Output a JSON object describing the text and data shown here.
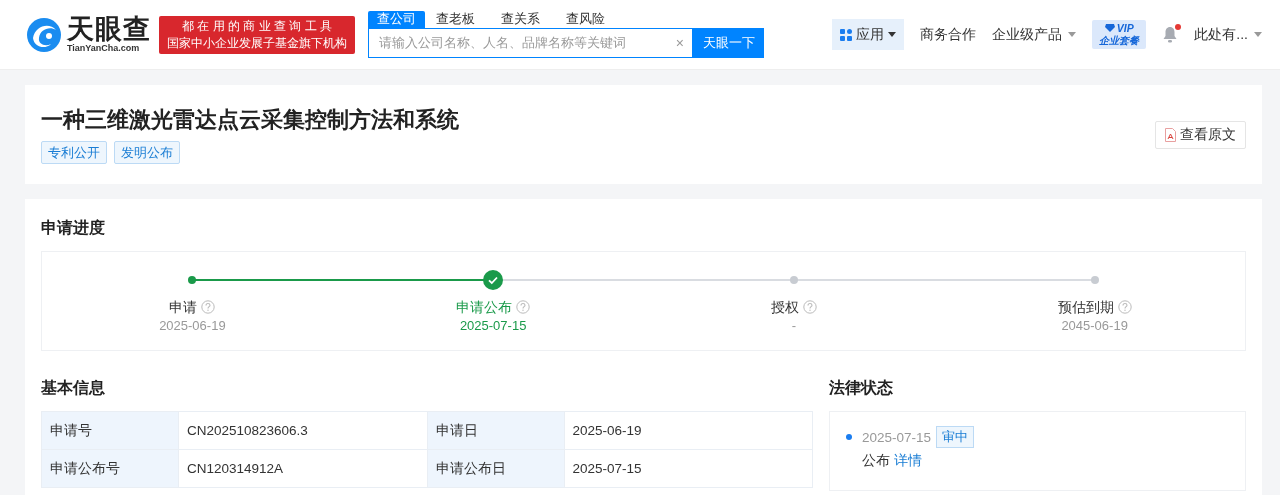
{
  "header": {
    "logo": {
      "name": "天眼查",
      "domain": "TianYanCha.com"
    },
    "slogan": [
      "都 在 用 的 商 业 查 询 工 具",
      "国家中小企业发展子基金旗下机构"
    ],
    "search_tabs": [
      {
        "label": "查公司",
        "selected": true
      },
      {
        "label": "查老板",
        "selected": false
      },
      {
        "label": "查关系",
        "selected": false
      },
      {
        "label": "查风险",
        "selected": false
      }
    ],
    "search": {
      "placeholder": "请输入公司名称、人名、品牌名称等关键词",
      "clear": "×",
      "button": "天眼一下"
    },
    "nav": [
      {
        "kind": "apps",
        "label": "应用"
      },
      {
        "kind": "link",
        "label": "商务合作"
      },
      {
        "kind": "dropdown",
        "label": "企业级产品"
      },
      {
        "kind": "vip",
        "label": "VIP",
        "sublabel": "企业套餐"
      },
      {
        "kind": "bell",
        "unread": true
      },
      {
        "kind": "dropdown",
        "label": "此处有..."
      }
    ]
  },
  "patent": {
    "title": "一种三维激光雷达点云采集控制方法和系统",
    "tags": [
      "专利公开",
      "发明公布"
    ],
    "view_button": "查看原文"
  },
  "progress": {
    "heading": "申请进度",
    "steps": [
      {
        "label": "申请",
        "date": "2025-06-19",
        "kind": "done"
      },
      {
        "label": "申请公布",
        "date": "2025-07-15",
        "kind": "current"
      },
      {
        "label": "授权",
        "date": "-",
        "kind": "pending"
      },
      {
        "label": "预估到期",
        "date": "2045-06-19",
        "kind": "pending"
      }
    ]
  },
  "basic_info": {
    "heading": "基本信息",
    "rows": [
      {
        "fields": [
          {
            "label": "申请号",
            "value": "CN202510823606.3"
          },
          {
            "label": "申请日",
            "value": "2025-06-19"
          }
        ]
      },
      {
        "fields": [
          {
            "label": "申请公布号",
            "value": "CN120314912A"
          },
          {
            "label": "申请公布日",
            "value": "2025-07-15"
          }
        ]
      }
    ]
  },
  "legal_status": {
    "heading": "法律状态",
    "events": [
      {
        "date": "2025-07-15",
        "badge": "审中",
        "action": "公布",
        "link": "详情"
      }
    ]
  }
}
